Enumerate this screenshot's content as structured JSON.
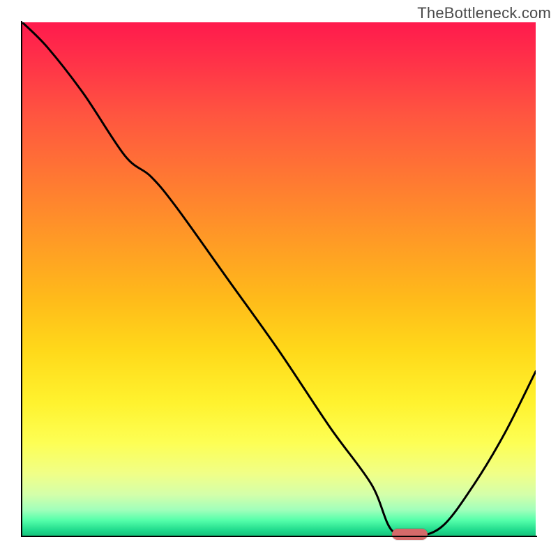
{
  "watermark": "TheBottleneck.com",
  "marker": {
    "x_percent": 73,
    "width_percent": 7,
    "color": "#d46a6a"
  },
  "chart_data": {
    "type": "line",
    "title": "",
    "xlabel": "",
    "ylabel": "",
    "xlim": [
      0,
      100
    ],
    "ylim": [
      0,
      100
    ],
    "grid": false,
    "legend_position": "none",
    "gradient_scale": [
      {
        "stop": 0,
        "color": "#ff1a4d",
        "meaning": "worst"
      },
      {
        "stop": 50,
        "color": "#ffd91a",
        "meaning": "mid"
      },
      {
        "stop": 100,
        "color": "#16c27b",
        "meaning": "best"
      }
    ],
    "series": [
      {
        "name": "bottleneck-curve",
        "x": [
          0,
          5,
          12,
          20,
          25,
          30,
          40,
          50,
          60,
          68,
          72,
          77,
          82,
          88,
          94,
          100
        ],
        "y": [
          100,
          95,
          86,
          74,
          70,
          64,
          50,
          36,
          21,
          10,
          1,
          0,
          2,
          10,
          20,
          32
        ]
      }
    ],
    "optimal_region": {
      "x_start": 72,
      "x_end": 79,
      "y": 0
    }
  }
}
